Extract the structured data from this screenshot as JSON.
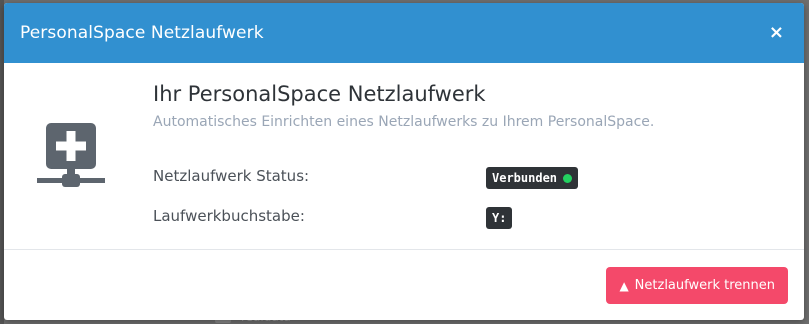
{
  "background": {
    "peek_text": "realdata"
  },
  "modal": {
    "title": "PersonalSpace Netzlaufwerk",
    "close_glyph": "×",
    "heading": "Ihr PersonalSpace Netzlaufwerk",
    "subheading": "Automatisches Einrichten eines Netzlaufwerks zu Ihrem PersonalSpace.",
    "icon": "network-drive-add-icon",
    "status": {
      "label": "Netzlaufwerk Status:",
      "value": "Verbunden",
      "indicator_color": "#23d160"
    },
    "drive_letter": {
      "label": "Laufwerkbuchstabe:",
      "value": "Y:"
    },
    "disconnect_button": {
      "label": "Netzlaufwerk trennen",
      "icon": "warning-icon",
      "color": "#f4496a"
    }
  },
  "colors": {
    "header": "#3190d0",
    "tag_bg": "#2f3337",
    "subheading": "#9aa6b6"
  }
}
